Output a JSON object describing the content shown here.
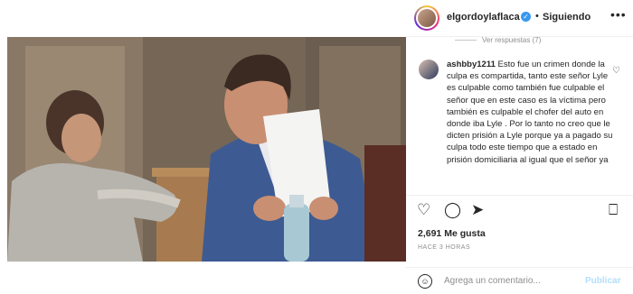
{
  "post_header": {
    "username": "elgordoylaflaca",
    "separator": "•",
    "follow_status": "Siguiendo",
    "more": "•••"
  },
  "comments": {
    "view_replies": "Ver respuestas (7)",
    "items": [
      {
        "username": "ashbby1211",
        "text": "Esto fue un crimen donde la culpa es compartida, tanto este señor Lyle es culpable como también fue culpable el señor que en este caso es la víctima pero también es culpable el chofer del auto en donde iba Lyle . Por lo tanto no creo que le dicten prisión a Lyle porque ya a pagado su culpa todo este tiempo que a estado en prisión domiciliaria al igual que el señor ya"
      }
    ]
  },
  "actions": {
    "like_icon": "heart-icon",
    "comment_icon": "comment-icon",
    "share_icon": "share-icon",
    "save_icon": "bookmark-icon"
  },
  "stats": {
    "likes": "2,691 Me gusta",
    "time_ago": "HACE 3 HORAS"
  },
  "comment_box": {
    "placeholder": "Agrega un comentario...",
    "publish_label": "Publicar",
    "emoji_icon": "emoji-icon"
  },
  "colors": {
    "verified": "#3897f0",
    "publish_disabled": "#b2dffc",
    "muted": "#8e8e8e"
  }
}
